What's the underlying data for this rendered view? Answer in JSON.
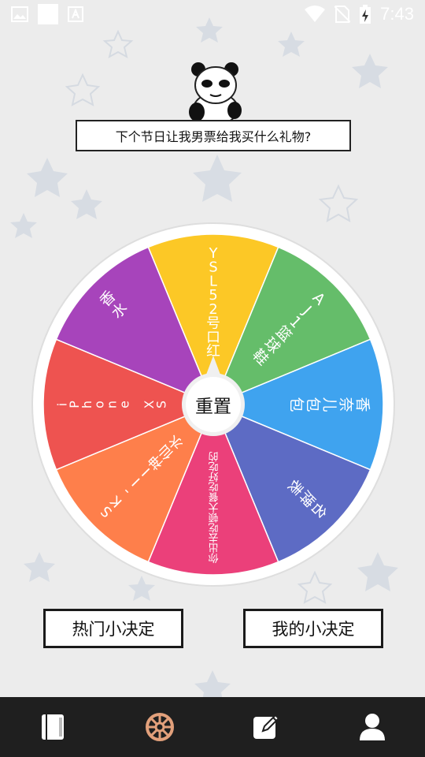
{
  "question": "下个节日让我男票给我买什么礼物?",
  "wheel": {
    "center_label": "重置",
    "segments": [
      {
        "label": "YSL52号口红",
        "color": "#fcc826"
      },
      {
        "label": "AJ1篮球鞋",
        "color": "#65bd6a"
      },
      {
        "label": "香奈儿包包",
        "color": "#3fa3ef"
      },
      {
        "label": "名牌表",
        "color": "#5d6bc4"
      },
      {
        "label": "你出去吃顿大餐吃好吃的",
        "color": "#eb407a"
      },
      {
        "label": "SK-II神仙水",
        "color": "#fe7f4b"
      },
      {
        "label": "iPhone XS",
        "color": "#ee5350"
      },
      {
        "label": "香水",
        "color": "#a744bb"
      }
    ],
    "rim_color": "#ffffff",
    "hub_color": "#f0f0f0"
  },
  "buttons": {
    "hot": "热门小决定",
    "mine": "我的小决定"
  },
  "status_bar": {
    "time": "7:43"
  },
  "nav": {
    "items": [
      "book-icon",
      "wheel-icon",
      "edit-icon",
      "profile-icon"
    ],
    "active_color": "#e2a07b"
  }
}
